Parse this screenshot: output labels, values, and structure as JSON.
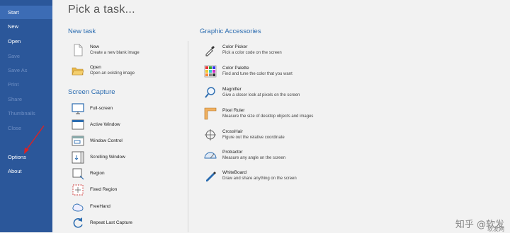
{
  "sidebar": {
    "items": [
      {
        "label": "Start",
        "state": "active"
      },
      {
        "label": "New",
        "state": "normal"
      },
      {
        "label": "Open",
        "state": "normal"
      },
      {
        "label": "Save",
        "state": "disabled"
      },
      {
        "label": "Save As",
        "state": "disabled"
      },
      {
        "label": "Print",
        "state": "disabled"
      },
      {
        "label": "Share",
        "state": "disabled"
      },
      {
        "label": "Thumbnails",
        "state": "disabled"
      },
      {
        "label": "Close",
        "state": "disabled"
      },
      {
        "label": "Options",
        "state": "normal"
      },
      {
        "label": "About",
        "state": "normal"
      }
    ]
  },
  "main": {
    "title": "Pick a task...",
    "new_task": {
      "heading": "New task",
      "items": [
        {
          "icon": "blank-page-icon",
          "title": "New",
          "desc": "Create a new blank image"
        },
        {
          "icon": "open-folder-icon",
          "title": "Open",
          "desc": "Open an existing image"
        }
      ]
    },
    "screen_capture": {
      "heading": "Screen Capture",
      "items": [
        {
          "icon": "monitor-icon",
          "title": "Full-screen"
        },
        {
          "icon": "window-icon",
          "title": "Active Window"
        },
        {
          "icon": "window-control-icon",
          "title": "Window Control"
        },
        {
          "icon": "scrolling-window-icon",
          "title": "Scrolling Window"
        },
        {
          "icon": "region-icon",
          "title": "Region"
        },
        {
          "icon": "fixed-region-icon",
          "title": "Fixed Region"
        },
        {
          "icon": "freehand-icon",
          "title": "FreeHand"
        },
        {
          "icon": "repeat-icon",
          "title": "Repeat Last Capture"
        }
      ]
    },
    "graphic_accessories": {
      "heading": "Graphic Accessories",
      "items": [
        {
          "icon": "eyedropper-icon",
          "title": "Color Picker",
          "desc": "Pick a color code on the screen"
        },
        {
          "icon": "color-palette-icon",
          "title": "Color Palette",
          "desc": "Find and tune the color that you want"
        },
        {
          "icon": "magnifier-icon",
          "title": "Magnifier",
          "desc": "Give a closer look at pixels on the screen"
        },
        {
          "icon": "pixel-ruler-icon",
          "title": "Pixel Ruler",
          "desc": "Measure the size of desktop objects and images"
        },
        {
          "icon": "crosshair-icon",
          "title": "CrossHair",
          "desc": "Figure out the relative coordinate"
        },
        {
          "icon": "protractor-icon",
          "title": "Protractor",
          "desc": "Measure any angle on the screen"
        },
        {
          "icon": "whiteboard-pen-icon",
          "title": "WhiteBoard",
          "desc": "Draw and share anything on the screen"
        }
      ]
    }
  },
  "watermark": {
    "text": "知乎 @软发",
    "sub": "软发网"
  },
  "colors": {
    "sidebar": "#2b579a",
    "sidebar_active": "#3c6cb5",
    "heading": "#2b6cb0",
    "arrow": "#e02020"
  }
}
